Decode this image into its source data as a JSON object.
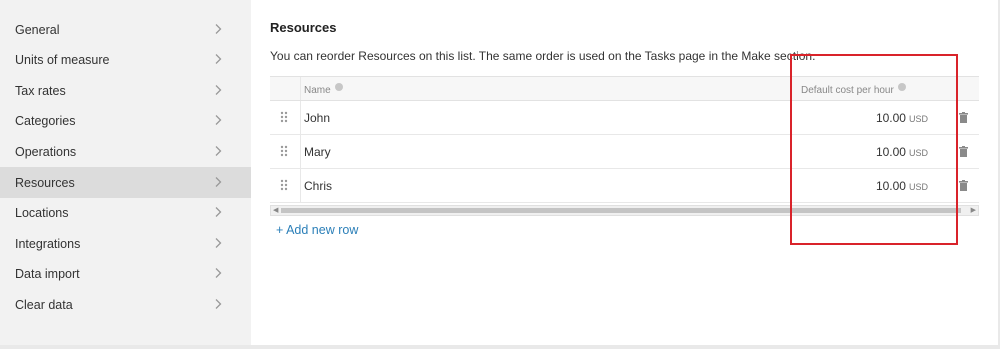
{
  "sidebar": {
    "items": [
      {
        "label": "General"
      },
      {
        "label": "Units of measure"
      },
      {
        "label": "Tax rates"
      },
      {
        "label": "Categories"
      },
      {
        "label": "Operations"
      },
      {
        "label": "Resources",
        "active": true
      },
      {
        "label": "Locations"
      },
      {
        "label": "Integrations"
      },
      {
        "label": "Data import"
      },
      {
        "label": "Clear data"
      }
    ]
  },
  "main": {
    "title": "Resources",
    "description": "You can reorder Resources on this list. The same order is used on the Tasks page in the Make section.",
    "table": {
      "columns": [
        "Name",
        "Default cost per hour"
      ],
      "rows": [
        {
          "name": "John",
          "cost": "10.00",
          "unit": "USD"
        },
        {
          "name": "Mary",
          "cost": "10.00",
          "unit": "USD"
        },
        {
          "name": "Chris",
          "cost": "10.00",
          "unit": "USD"
        }
      ]
    },
    "add_row_label": "+ Add new row"
  },
  "colors": {
    "sidebar_bg": "#f2f2f2",
    "active_item_bg": "#dcdcdc",
    "link": "#2b7fb8",
    "highlight": "#d9232a"
  },
  "icons": [
    "chevron-right-icon",
    "drag-handle-icon",
    "trash-icon",
    "info-icon"
  ]
}
